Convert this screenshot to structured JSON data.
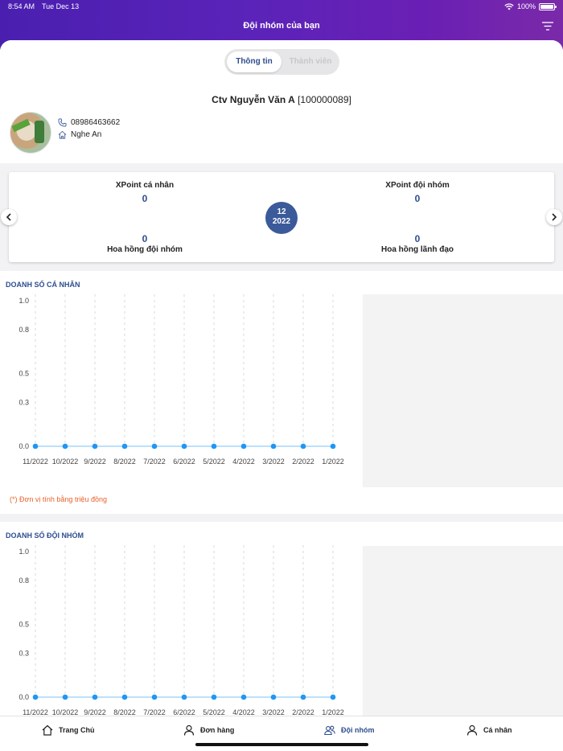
{
  "status_bar": {
    "time": "8:54 AM",
    "date": "Tue Dec 13",
    "battery": "100%"
  },
  "header": {
    "title": "Đội nhóm của bạn",
    "filter_icon": "filter-icon"
  },
  "segment": {
    "active": "Thông tin",
    "inactive": "Thành viên"
  },
  "profile": {
    "name": "Ctv Nguyễn Văn A",
    "code": "[100000089]",
    "phone": "08986463662",
    "address": "Nghe An"
  },
  "kpi": {
    "personal_label": "XPoint cá nhân",
    "personal_value": "0",
    "team_label": "XPoint đội nhóm",
    "team_value": "0",
    "team_commission_label": "Hoa hồng đội nhóm",
    "team_commission_value": "0",
    "leader_commission_label": "Hoa hồng lãnh đạo",
    "leader_commission_value": "0",
    "month": "12",
    "year": "2022"
  },
  "personal_sales": {
    "title": "DOANH SỐ CÁ NHÂN",
    "note": "(*) Đơn vị tính bằng triệu đồng"
  },
  "team_sales": {
    "title": "DOANH SỐ ĐỘI NHÓM"
  },
  "chart_data": [
    {
      "type": "line",
      "title": "DOANH SỐ CÁ NHÂN",
      "categories": [
        "11/2022",
        "10/2022",
        "9/2022",
        "8/2022",
        "7/2022",
        "6/2022",
        "5/2022",
        "4/2022",
        "3/2022",
        "2/2022",
        "1/2022"
      ],
      "values": [
        0,
        0,
        0,
        0,
        0,
        0,
        0,
        0,
        0,
        0,
        0
      ],
      "yticks": [
        "0.0",
        "0.3",
        "0.5",
        "0.8",
        "1.0"
      ],
      "ylim": [
        0,
        1
      ],
      "grid": "vertical dashed",
      "color": "#2196f3"
    },
    {
      "type": "line",
      "title": "DOANH SỐ ĐỘI NHÓM",
      "categories": [
        "11/2022",
        "10/2022",
        "9/2022",
        "8/2022",
        "7/2022",
        "6/2022",
        "5/2022",
        "4/2022",
        "3/2022",
        "2/2022",
        "1/2022"
      ],
      "values": [
        0,
        0,
        0,
        0,
        0,
        0,
        0,
        0,
        0,
        0,
        0
      ],
      "yticks": [
        "0.0",
        "0.3",
        "0.5",
        "0.8",
        "1.0"
      ],
      "ylim": [
        0,
        1
      ],
      "grid": "vertical dashed",
      "color": "#2196f3"
    }
  ],
  "tabs": [
    {
      "label": "Trang Chủ",
      "icon": "home-icon"
    },
    {
      "label": "Đơn hàng",
      "icon": "user-icon"
    },
    {
      "label": "Đội nhóm",
      "icon": "team-icon",
      "active": true
    },
    {
      "label": "Cá nhân",
      "icon": "person-icon"
    }
  ]
}
